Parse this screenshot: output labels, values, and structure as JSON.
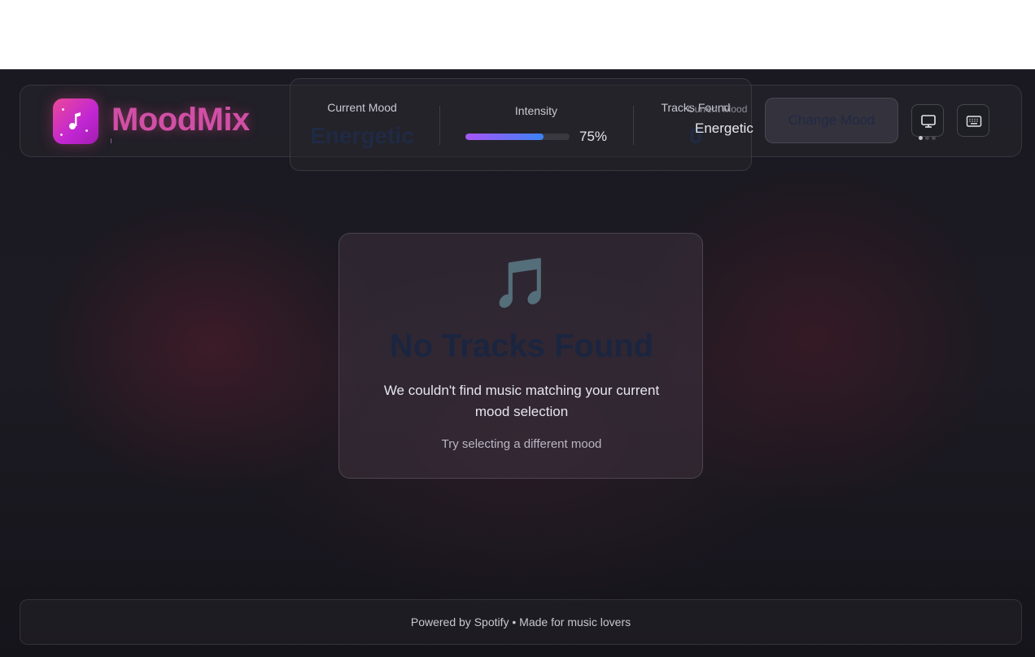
{
  "app": {
    "brand": "MoodMix",
    "accent_color": "#ec4899"
  },
  "stats": {
    "current_mood_label": "Current Mood",
    "current_mood_value": "Energetic",
    "intensity_label": "Intensity",
    "intensity_percent": 75,
    "intensity_text": "75%",
    "tracks_found_label": "Tracks Found",
    "tracks_found_value": "0"
  },
  "tooltip": {
    "label": "Current Mood",
    "value": "Energetic"
  },
  "header": {
    "change_mood_label": "Change Mood",
    "icons": [
      "desktop-icon",
      "keyboard-icon"
    ]
  },
  "empty_state": {
    "icon": "🎵",
    "title": "No Tracks Found",
    "description": "We couldn't find music matching your current mood selection",
    "hint": "Try selecting a different mood"
  },
  "footer": {
    "text": "Powered by Spotify • Made for music lovers"
  }
}
